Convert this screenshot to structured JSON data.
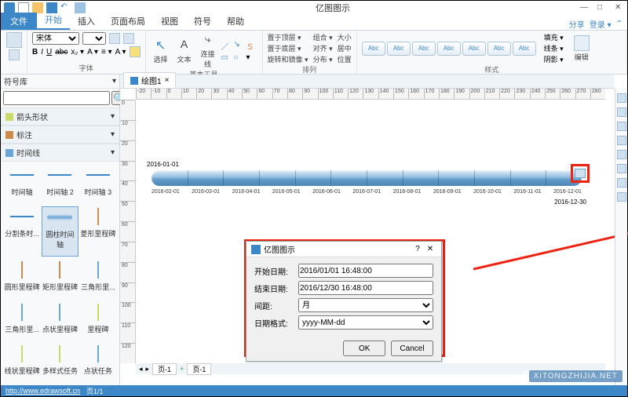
{
  "app_title": "亿图图示",
  "qat_icons": [
    "logo",
    "new",
    "open",
    "save",
    "undo",
    "diagram"
  ],
  "win_buttons": {
    "min": "—",
    "max": "□",
    "close": "✕"
  },
  "ribbon": {
    "file": "文件",
    "tabs": [
      "开始",
      "插入",
      "页面布局",
      "视图",
      "符号",
      "帮助"
    ],
    "active_tab": "开始",
    "right_links": {
      "share": "分享",
      "login": "登录 ▾"
    },
    "font": {
      "family": "宋体",
      "size": "",
      "bold": "B",
      "italic": "I",
      "underline": "U",
      "strike": "abc",
      "more": "x₂ ▾",
      "case": "A ▾",
      "bullet": "≡ ▾",
      "a2": "A ▾",
      "group_label": "字体"
    },
    "tools": {
      "select": "选择",
      "text": "文本",
      "connector": "连接线",
      "line_ic": "／",
      "arrow_ic": "↘",
      "curve_ic": "Ｓ",
      "rect_ic": "▭",
      "circle_ic": "○",
      "drop": "▾",
      "group_label": "基本工具"
    },
    "arrange": {
      "front": "置于顶层 ▾",
      "group": "组合 ▾",
      "size": "大小",
      "back": "置于底层 ▾",
      "align": "对齐 ▾",
      "center": "居中",
      "rotate": "旋转和镜像 ▾",
      "distribute": "分布 ▾",
      "pos": "位置",
      "group_label": "排列"
    },
    "styles": {
      "chip": "Abc",
      "fill": "填充 ▾",
      "line": "线条 ▾",
      "shadow": "阴影 ▾",
      "edit_label": "编辑",
      "group_label": "样式"
    }
  },
  "left_panel": {
    "title": "符号库",
    "search_placeholder": "",
    "search_icon": "🔍",
    "cats": [
      {
        "label": "箭头形状",
        "color": "#c9d96a"
      },
      {
        "label": "标注",
        "color": "#d28a4a"
      },
      {
        "label": "时间线",
        "color": "#6aa5d8"
      }
    ],
    "shapes": [
      {
        "label": "时间轴",
        "kind": "line"
      },
      {
        "label": "时间轴 2",
        "kind": "line"
      },
      {
        "label": "时间轴 3",
        "kind": "line"
      },
      {
        "label": "分割条时...",
        "kind": "line"
      },
      {
        "label": "圆柱时间轴",
        "kind": "cyl",
        "selected": true
      },
      {
        "label": "菱形里程碑",
        "kind": "stick",
        "color": "#d28a4a"
      },
      {
        "label": "圆形里程碑",
        "kind": "stick",
        "color": "#d28a4a"
      },
      {
        "label": "矩形里程碑",
        "kind": "stick",
        "color": "#d28a4a"
      },
      {
        "label": "三角形里...",
        "kind": "stick",
        "color": "#6aa5d8"
      },
      {
        "label": "三角形里...",
        "kind": "stick",
        "color": "#6aa5d8"
      },
      {
        "label": "点状里程碑",
        "kind": "stick",
        "color": "#6aa5d8"
      },
      {
        "label": "里程碑",
        "kind": "stick",
        "color": "#c9d96a"
      },
      {
        "label": "线状里程碑",
        "kind": "stick",
        "color": "#c9d96a"
      },
      {
        "label": "多样式任务",
        "kind": "stick",
        "color": "#c9d96a"
      },
      {
        "label": "点状任务",
        "kind": "stick",
        "color": "#6aa5d8"
      }
    ]
  },
  "doc_tab": {
    "label": "绘图1",
    "close": "×"
  },
  "ruler_h": [
    "-20",
    "-10",
    "0",
    "10",
    "20",
    "30",
    "40",
    "50",
    "60",
    "70",
    "80",
    "90",
    "100",
    "110",
    "120",
    "130",
    "140",
    "150",
    "160",
    "170",
    "180",
    "190",
    "200",
    "210",
    "220",
    "230",
    "240",
    "250",
    "260",
    "270",
    "280"
  ],
  "ruler_v": [
    "0",
    "10",
    "20",
    "30",
    "40",
    "50",
    "60",
    "70",
    "80",
    "90",
    "100",
    "110",
    "120"
  ],
  "timeline": {
    "start": "2016-01-01",
    "end": "2016-12-30",
    "ticks": [
      "2016-02-01",
      "2016-03-01",
      "2016-04-01",
      "2016-05-01",
      "2016-06-01",
      "2016-07-01",
      "2016-08-01",
      "2016-09-01",
      "2016-10-01",
      "2016-11-01",
      "2016-12-01"
    ]
  },
  "dialog": {
    "title": "亿图图示",
    "help": "?",
    "close": "✕",
    "labels": {
      "start": "开始日期:",
      "end": "结束日期:",
      "interval": "间距:",
      "format": "日期格式:"
    },
    "values": {
      "start": "2016/01/01 16:48:00",
      "end": "2016/12/30 16:48:00",
      "interval": "月",
      "format": "yyyy-MM-dd"
    },
    "buttons": {
      "ok": "OK",
      "cancel": "Cancel"
    }
  },
  "page_tabs": {
    "nav": [
      "◂",
      "▸"
    ],
    "page": "页-1",
    "add": "+",
    "page2": "页-1"
  },
  "palette_label": "填充:",
  "status": {
    "url": "http://www.edrawsoft.cn",
    "page": "页1/1"
  },
  "watermark": "XITONGZHIJIA.NET"
}
